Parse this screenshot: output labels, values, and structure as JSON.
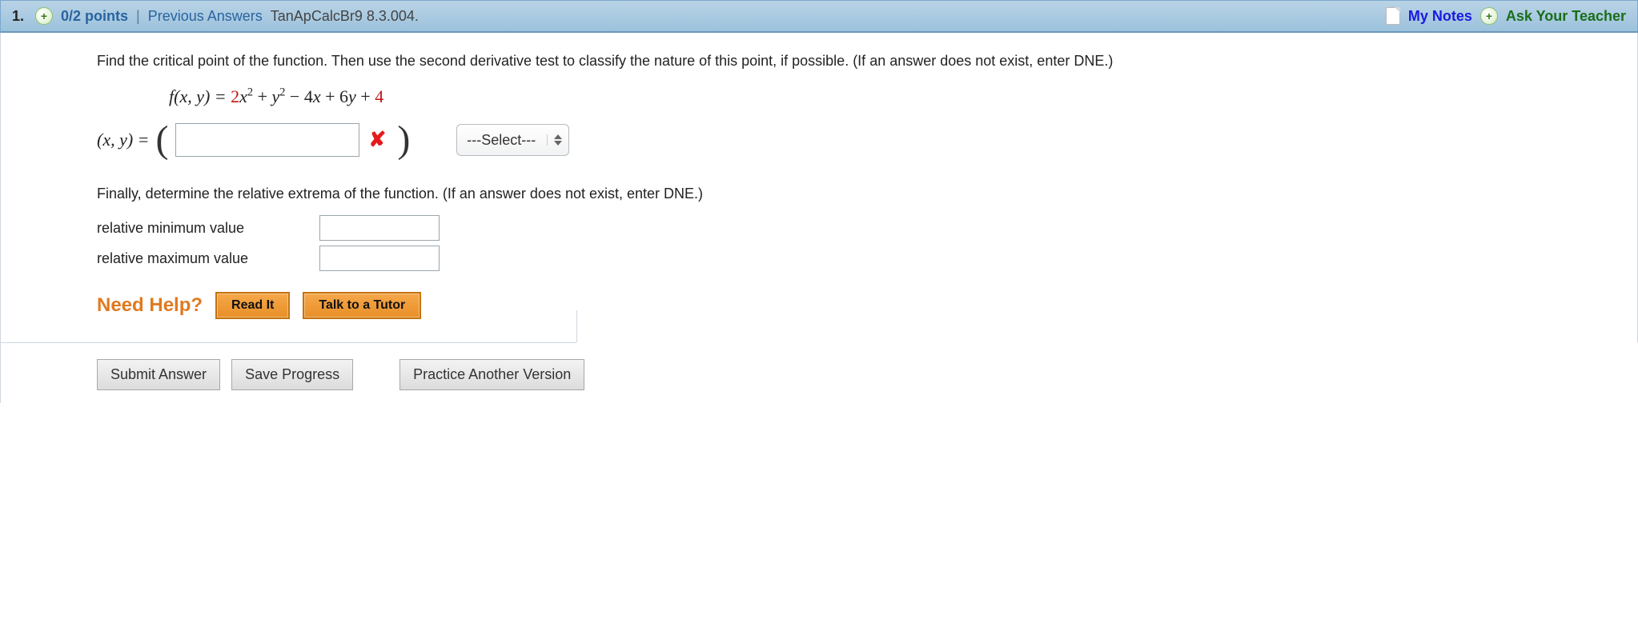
{
  "header": {
    "question_number": "1.",
    "points_text": "0/2 points",
    "previous_answers": "Previous Answers",
    "problem_id": "TanApCalcBr9 8.3.004.",
    "my_notes": "My Notes",
    "ask_teacher": "Ask Your Teacher"
  },
  "prompt": {
    "main": "Find the critical point of the function. Then use the second derivative test to classify the nature of this point, if possible. (If an answer does not exist, enter DNE.)"
  },
  "equation": {
    "lhs": "f(x, y) = ",
    "t1_coef": "2",
    "t1_var": "x",
    "plus1": " + ",
    "t2_var": "y",
    "minus": " − ",
    "t3": "4x",
    "plus2": " + ",
    "t4": "6y",
    "plus3": " + ",
    "const_hl": "4"
  },
  "critical_point": {
    "label": "(x, y) = ",
    "value": "",
    "select_value": "---Select---"
  },
  "extrema": {
    "prompt": "Finally, determine the relative extrema of the function. (If an answer does not exist, enter DNE.)",
    "min_label": "relative minimum value",
    "min_value": "",
    "max_label": "relative maximum value",
    "max_value": ""
  },
  "help": {
    "label": "Need Help?",
    "read_it": "Read It",
    "talk_tutor": "Talk to a Tutor"
  },
  "buttons": {
    "submit": "Submit Answer",
    "save": "Save Progress",
    "practice": "Practice Another Version"
  }
}
